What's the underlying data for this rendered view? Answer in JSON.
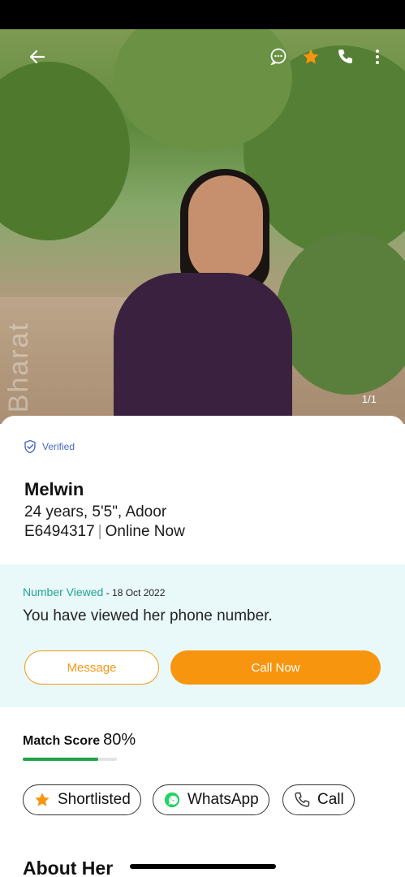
{
  "photo": {
    "watermark": "Bharat",
    "counter": "1/1"
  },
  "top_bar": {
    "back_icon": "arrow-left-icon",
    "chat_icon": "chat-bubble-icon",
    "star_icon": "star-icon",
    "phone_icon": "phone-icon",
    "more_icon": "more-vertical-icon"
  },
  "profile": {
    "verified_label": "Verified",
    "name": "Melwin",
    "age_height_location": "24 years, 5'5\", Adoor",
    "profile_id": "E6494317",
    "status": "Online Now"
  },
  "number_viewed": {
    "title": "Number Viewed",
    "date": " - 18 Oct 2022",
    "message": "You have viewed her phone number.",
    "message_button": "Message",
    "call_button": "Call Now"
  },
  "match": {
    "label": "Match Score",
    "value": "80%",
    "fraction": 0.8
  },
  "actions": {
    "shortlisted": "Shortlisted",
    "whatsapp": "WhatsApp",
    "call": "Call"
  },
  "sections": {
    "about_heading": "About Her"
  },
  "colors": {
    "accent": "#f7950e",
    "teal": "#23a492",
    "verified_blue": "#4a68c4",
    "match_green": "#1fa24a",
    "whatsapp_green": "#25d366"
  }
}
